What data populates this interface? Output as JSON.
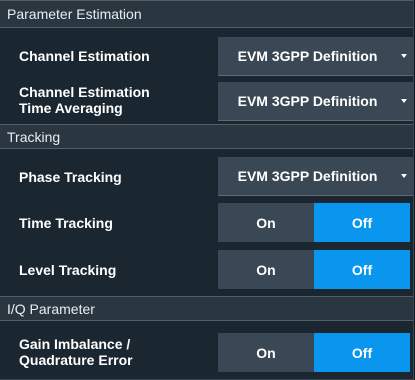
{
  "sections": {
    "parameter_estimation": {
      "title": "Parameter Estimation",
      "channel_estimation": {
        "label": "Channel Estimation",
        "value": "EVM 3GPP Definition"
      },
      "channel_estimation_time_averaging": {
        "label_line1": "Channel Estimation",
        "label_line2": "Time Averaging",
        "value": "EVM 3GPP Definition"
      }
    },
    "tracking": {
      "title": "Tracking",
      "phase_tracking": {
        "label": "Phase Tracking",
        "value": "EVM 3GPP Definition"
      },
      "time_tracking": {
        "label": "Time Tracking",
        "on": "On",
        "off": "Off",
        "selected": "Off"
      },
      "level_tracking": {
        "label": "Level Tracking",
        "on": "On",
        "off": "Off",
        "selected": "Off"
      }
    },
    "iq_parameter": {
      "title": "I/Q Parameter",
      "gain_imbalance": {
        "label_line1": "Gain Imbalance /",
        "label_line2": "Quadrature Error",
        "on": "On",
        "off": "Off",
        "selected": "Off"
      }
    }
  },
  "colors": {
    "panel_bg": "#1b2730",
    "header_bg": "#2a3640",
    "control_bg": "#3a4754",
    "selected_blue": "#0a96ee"
  },
  "icons": {
    "dropdown_caret": "caret-down-icon"
  }
}
